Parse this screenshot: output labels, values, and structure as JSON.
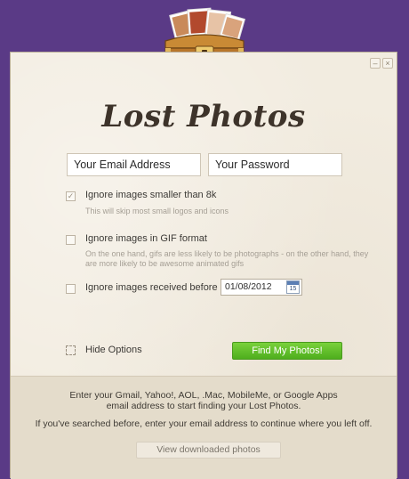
{
  "app": {
    "logo_text": "Lost Photos"
  },
  "login": {
    "email_value": "Your Email Address",
    "password_value": "Your Password"
  },
  "options": {
    "ignore_small": {
      "label": "Ignore images smaller than 8k",
      "help": "This will skip most small logos and icons",
      "checked": true
    },
    "ignore_gif": {
      "label": "Ignore images in GIF format",
      "help": "On the one hand, gifs are less likely to be photographs - on the other hand, they are more likely to be awesome animated gifs",
      "checked": false
    },
    "ignore_before": {
      "label": "Ignore images received before",
      "date": "01/08/2012",
      "calendar_day": "15",
      "checked": false
    },
    "hide_options_label": "Hide Options"
  },
  "actions": {
    "find_label": "Find My Photos!"
  },
  "footer": {
    "line1": "Enter your Gmail, Yahoo!, AOL, .Mac, MobileMe, or Google Apps",
    "line2": "email address to start finding your Lost Photos.",
    "line3": "If you've searched before, enter your email address to continue where you left off.",
    "view_label": "View downloaded photos"
  },
  "colors": {
    "background": "#5a3a86",
    "panel": "#f2ece0",
    "accent_green": "#5cbf25"
  },
  "icons": [
    "treasure-chest-logo",
    "minimize-icon",
    "close-icon",
    "calendar-icon",
    "checkbox-checked-icon"
  ]
}
